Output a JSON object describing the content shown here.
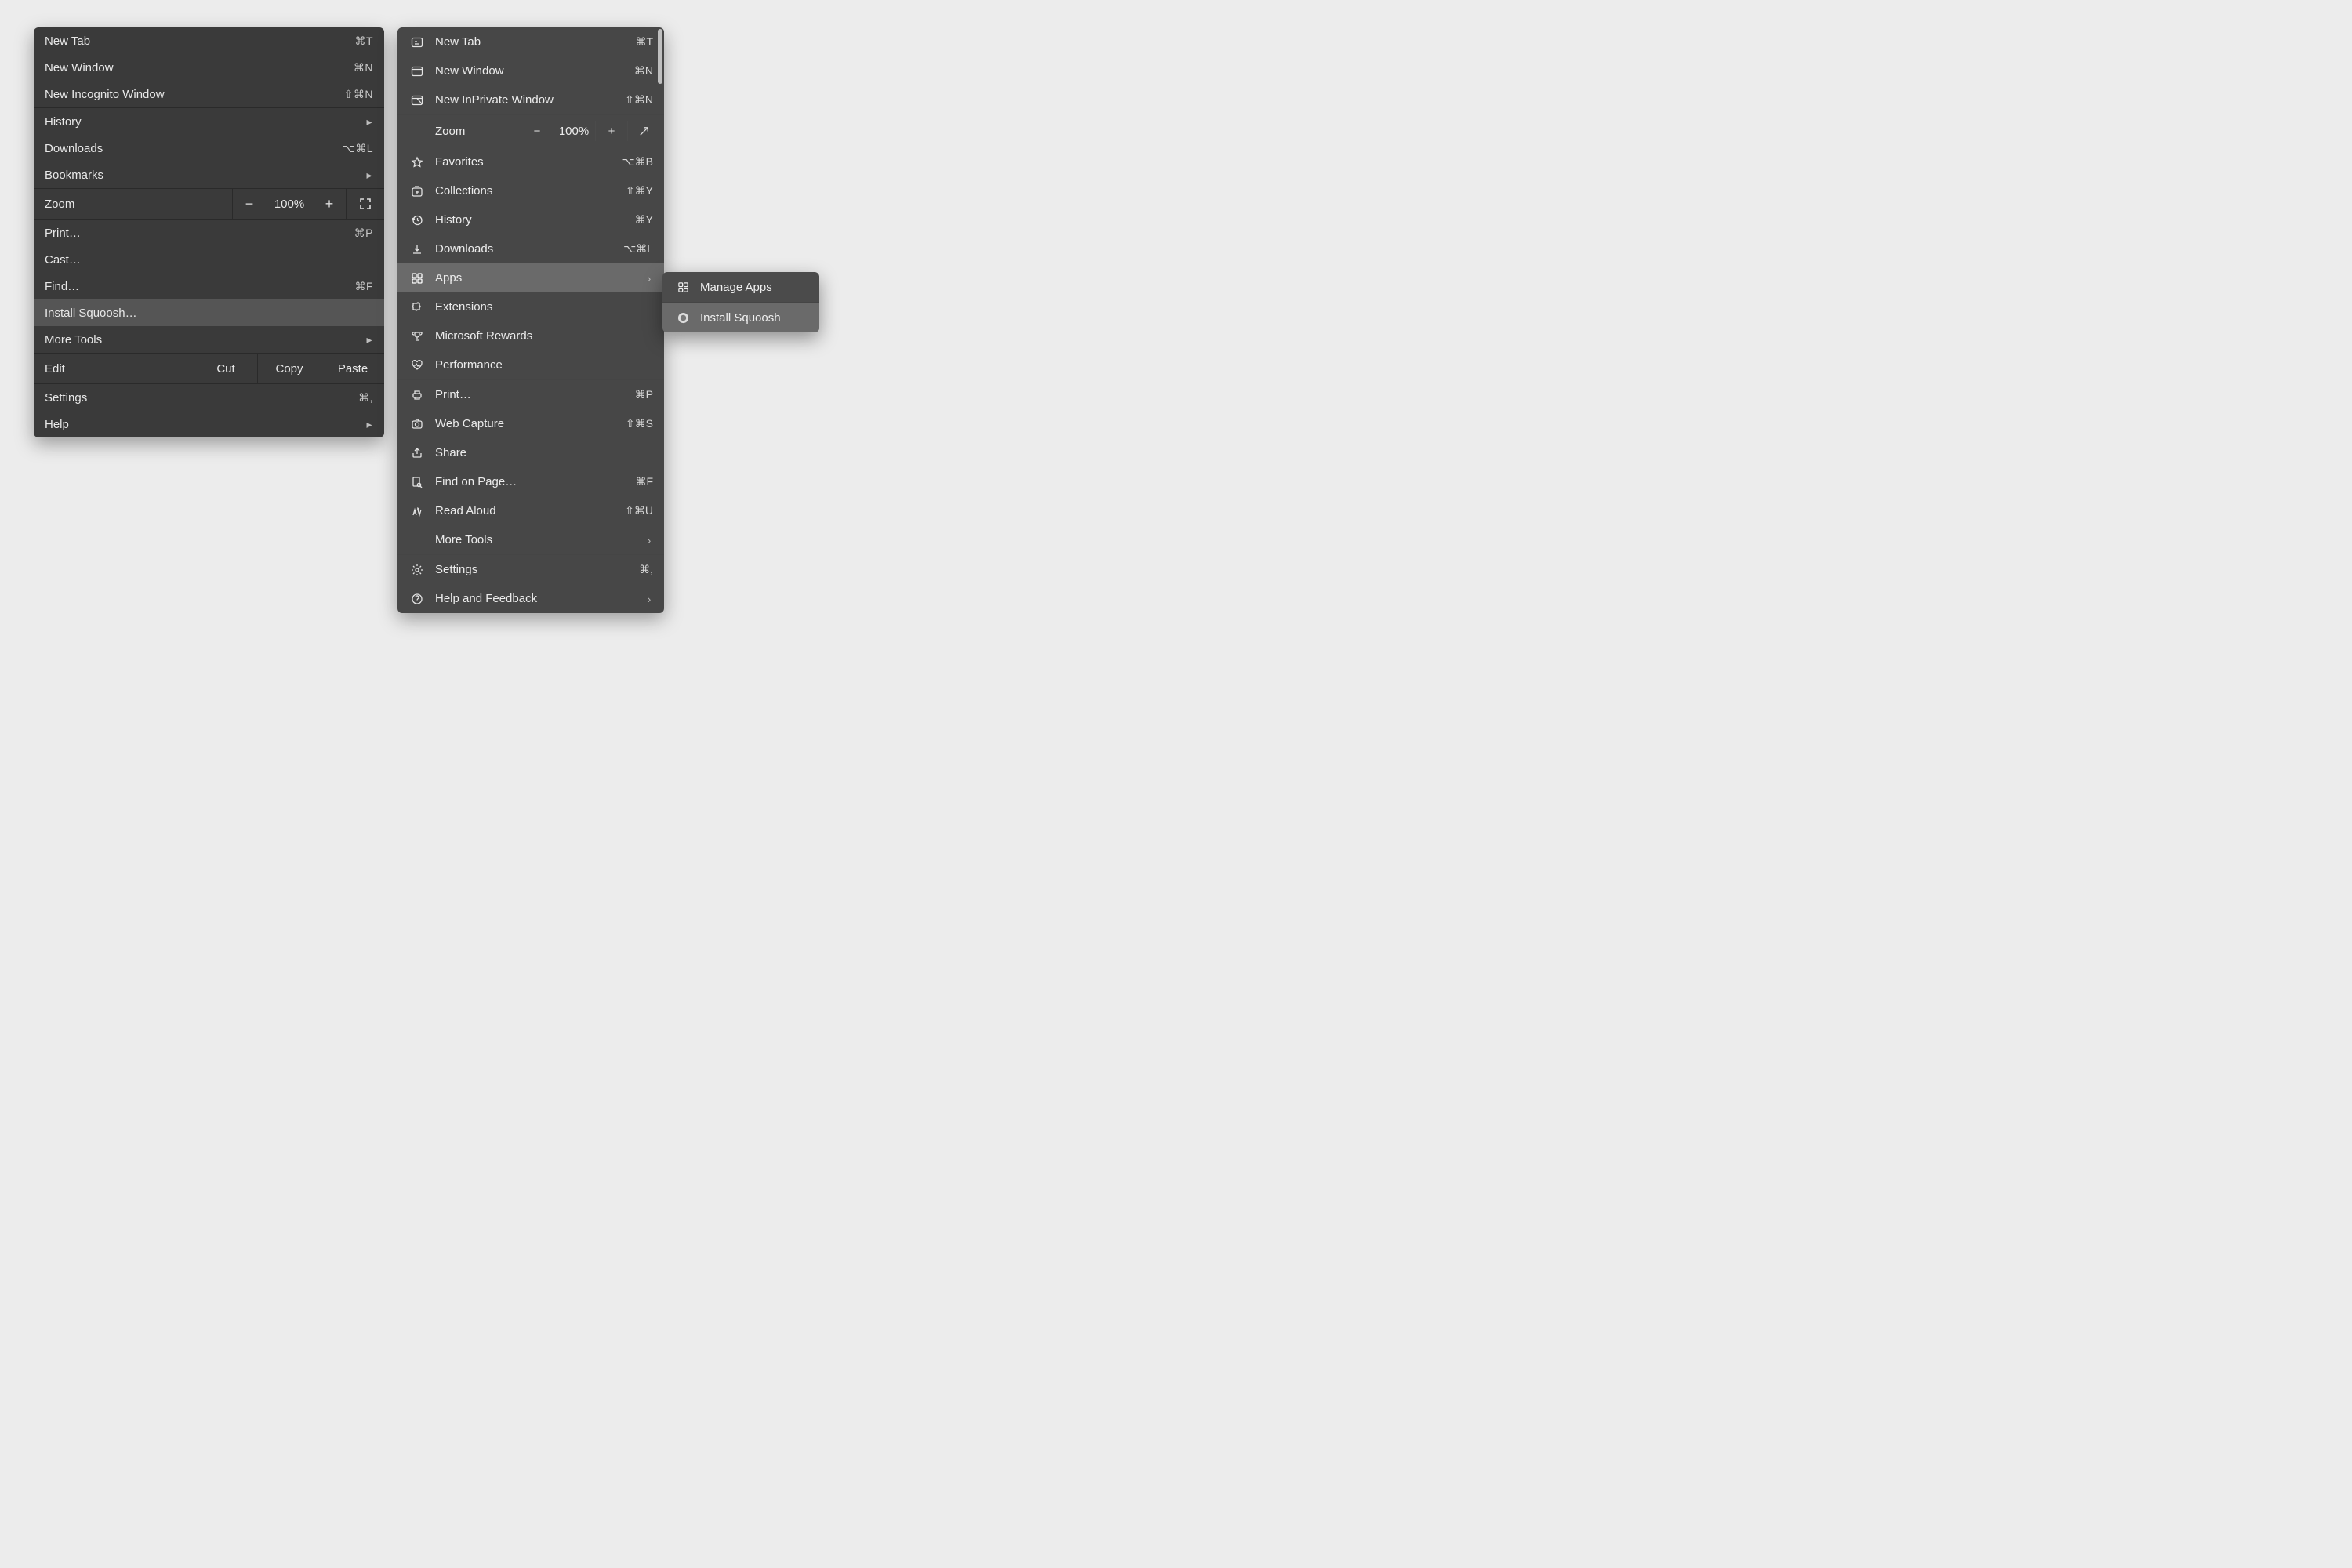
{
  "chrome": {
    "group1": [
      {
        "label": "New Tab",
        "shortcut": "⌘T"
      },
      {
        "label": "New Window",
        "shortcut": "⌘N"
      },
      {
        "label": "New Incognito Window",
        "shortcut": "⇧⌘N"
      }
    ],
    "history": "History",
    "downloads": {
      "label": "Downloads",
      "shortcut": "⌥⌘L"
    },
    "bookmarks": "Bookmarks",
    "zoom": {
      "label": "Zoom",
      "value": "100%"
    },
    "print": {
      "label": "Print…",
      "shortcut": "⌘P"
    },
    "cast": "Cast…",
    "find": {
      "label": "Find…",
      "shortcut": "⌘F"
    },
    "install": "Install Squoosh…",
    "moretools": "More Tools",
    "edit": {
      "label": "Edit",
      "cut": "Cut",
      "copy": "Copy",
      "paste": "Paste"
    },
    "settings": {
      "label": "Settings",
      "shortcut": "⌘,"
    },
    "help": "Help"
  },
  "edge": {
    "group1": [
      {
        "label": "New Tab",
        "shortcut": "⌘T"
      },
      {
        "label": "New Window",
        "shortcut": "⌘N"
      },
      {
        "label": "New InPrivate Window",
        "shortcut": "⇧⌘N"
      }
    ],
    "zoom": {
      "label": "Zoom",
      "value": "100%"
    },
    "group2": [
      {
        "label": "Favorites",
        "shortcut": "⌥⌘B",
        "icon": "star"
      },
      {
        "label": "Collections",
        "shortcut": "⇧⌘Y",
        "icon": "collections"
      },
      {
        "label": "History",
        "shortcut": "⌘Y",
        "icon": "history"
      },
      {
        "label": "Downloads",
        "shortcut": "⌥⌘L",
        "icon": "download"
      }
    ],
    "apps": "Apps",
    "group3": [
      {
        "label": "Extensions",
        "icon": "puzzle"
      },
      {
        "label": "Microsoft Rewards",
        "icon": "trophy"
      },
      {
        "label": "Performance",
        "icon": "heart"
      }
    ],
    "group4": [
      {
        "label": "Print…",
        "shortcut": "⌘P",
        "icon": "printer"
      },
      {
        "label": "Web Capture",
        "shortcut": "⇧⌘S",
        "icon": "capture"
      },
      {
        "label": "Share",
        "icon": "share"
      },
      {
        "label": "Find on Page…",
        "shortcut": "⌘F",
        "icon": "find"
      },
      {
        "label": "Read Aloud",
        "shortcut": "⇧⌘U",
        "icon": "readaloud"
      }
    ],
    "moretools": "More Tools",
    "group5": [
      {
        "label": "Settings",
        "shortcut": "⌘,",
        "icon": "gear"
      },
      {
        "label": "Help and Feedback",
        "icon": "help",
        "chev": true
      }
    ],
    "submenu": {
      "manage": "Manage Apps",
      "install": "Install Squoosh"
    }
  }
}
